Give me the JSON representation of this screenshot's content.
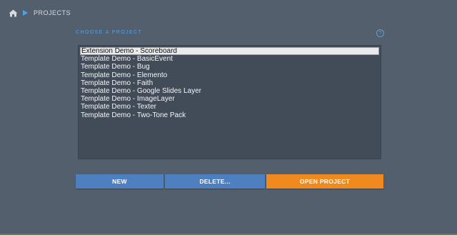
{
  "breadcrumb": {
    "home_icon": "home-icon",
    "separator_icon": "play-icon",
    "current": "PROJECTS"
  },
  "chooser": {
    "title": "CHOOSE A PROJECT",
    "help_icon": "help-icon",
    "help_glyph": "?"
  },
  "projects": [
    {
      "name": "Extension Demo - Scoreboard",
      "selected": true
    },
    {
      "name": "Template Demo - BasicEvent",
      "selected": false
    },
    {
      "name": "Template Demo - Bug",
      "selected": false
    },
    {
      "name": "Template Demo - Elemento",
      "selected": false
    },
    {
      "name": "Template Demo - Faith",
      "selected": false
    },
    {
      "name": "Template Demo - Google Slides Layer",
      "selected": false
    },
    {
      "name": "Template Demo - ImageLayer",
      "selected": false
    },
    {
      "name": "Template Demo - Texter",
      "selected": false
    },
    {
      "name": "Template Demo - Two-Tone Pack",
      "selected": false
    }
  ],
  "buttons": {
    "new_label": "NEW",
    "delete_label": "DELETE...",
    "open_label": "OPEN PROJECT"
  },
  "colors": {
    "background": "#545f6d",
    "accent_blue": "#4ea3e8",
    "button_blue": "#4d7fc1",
    "button_orange": "#f08a1f",
    "list_background": "#424c58"
  }
}
